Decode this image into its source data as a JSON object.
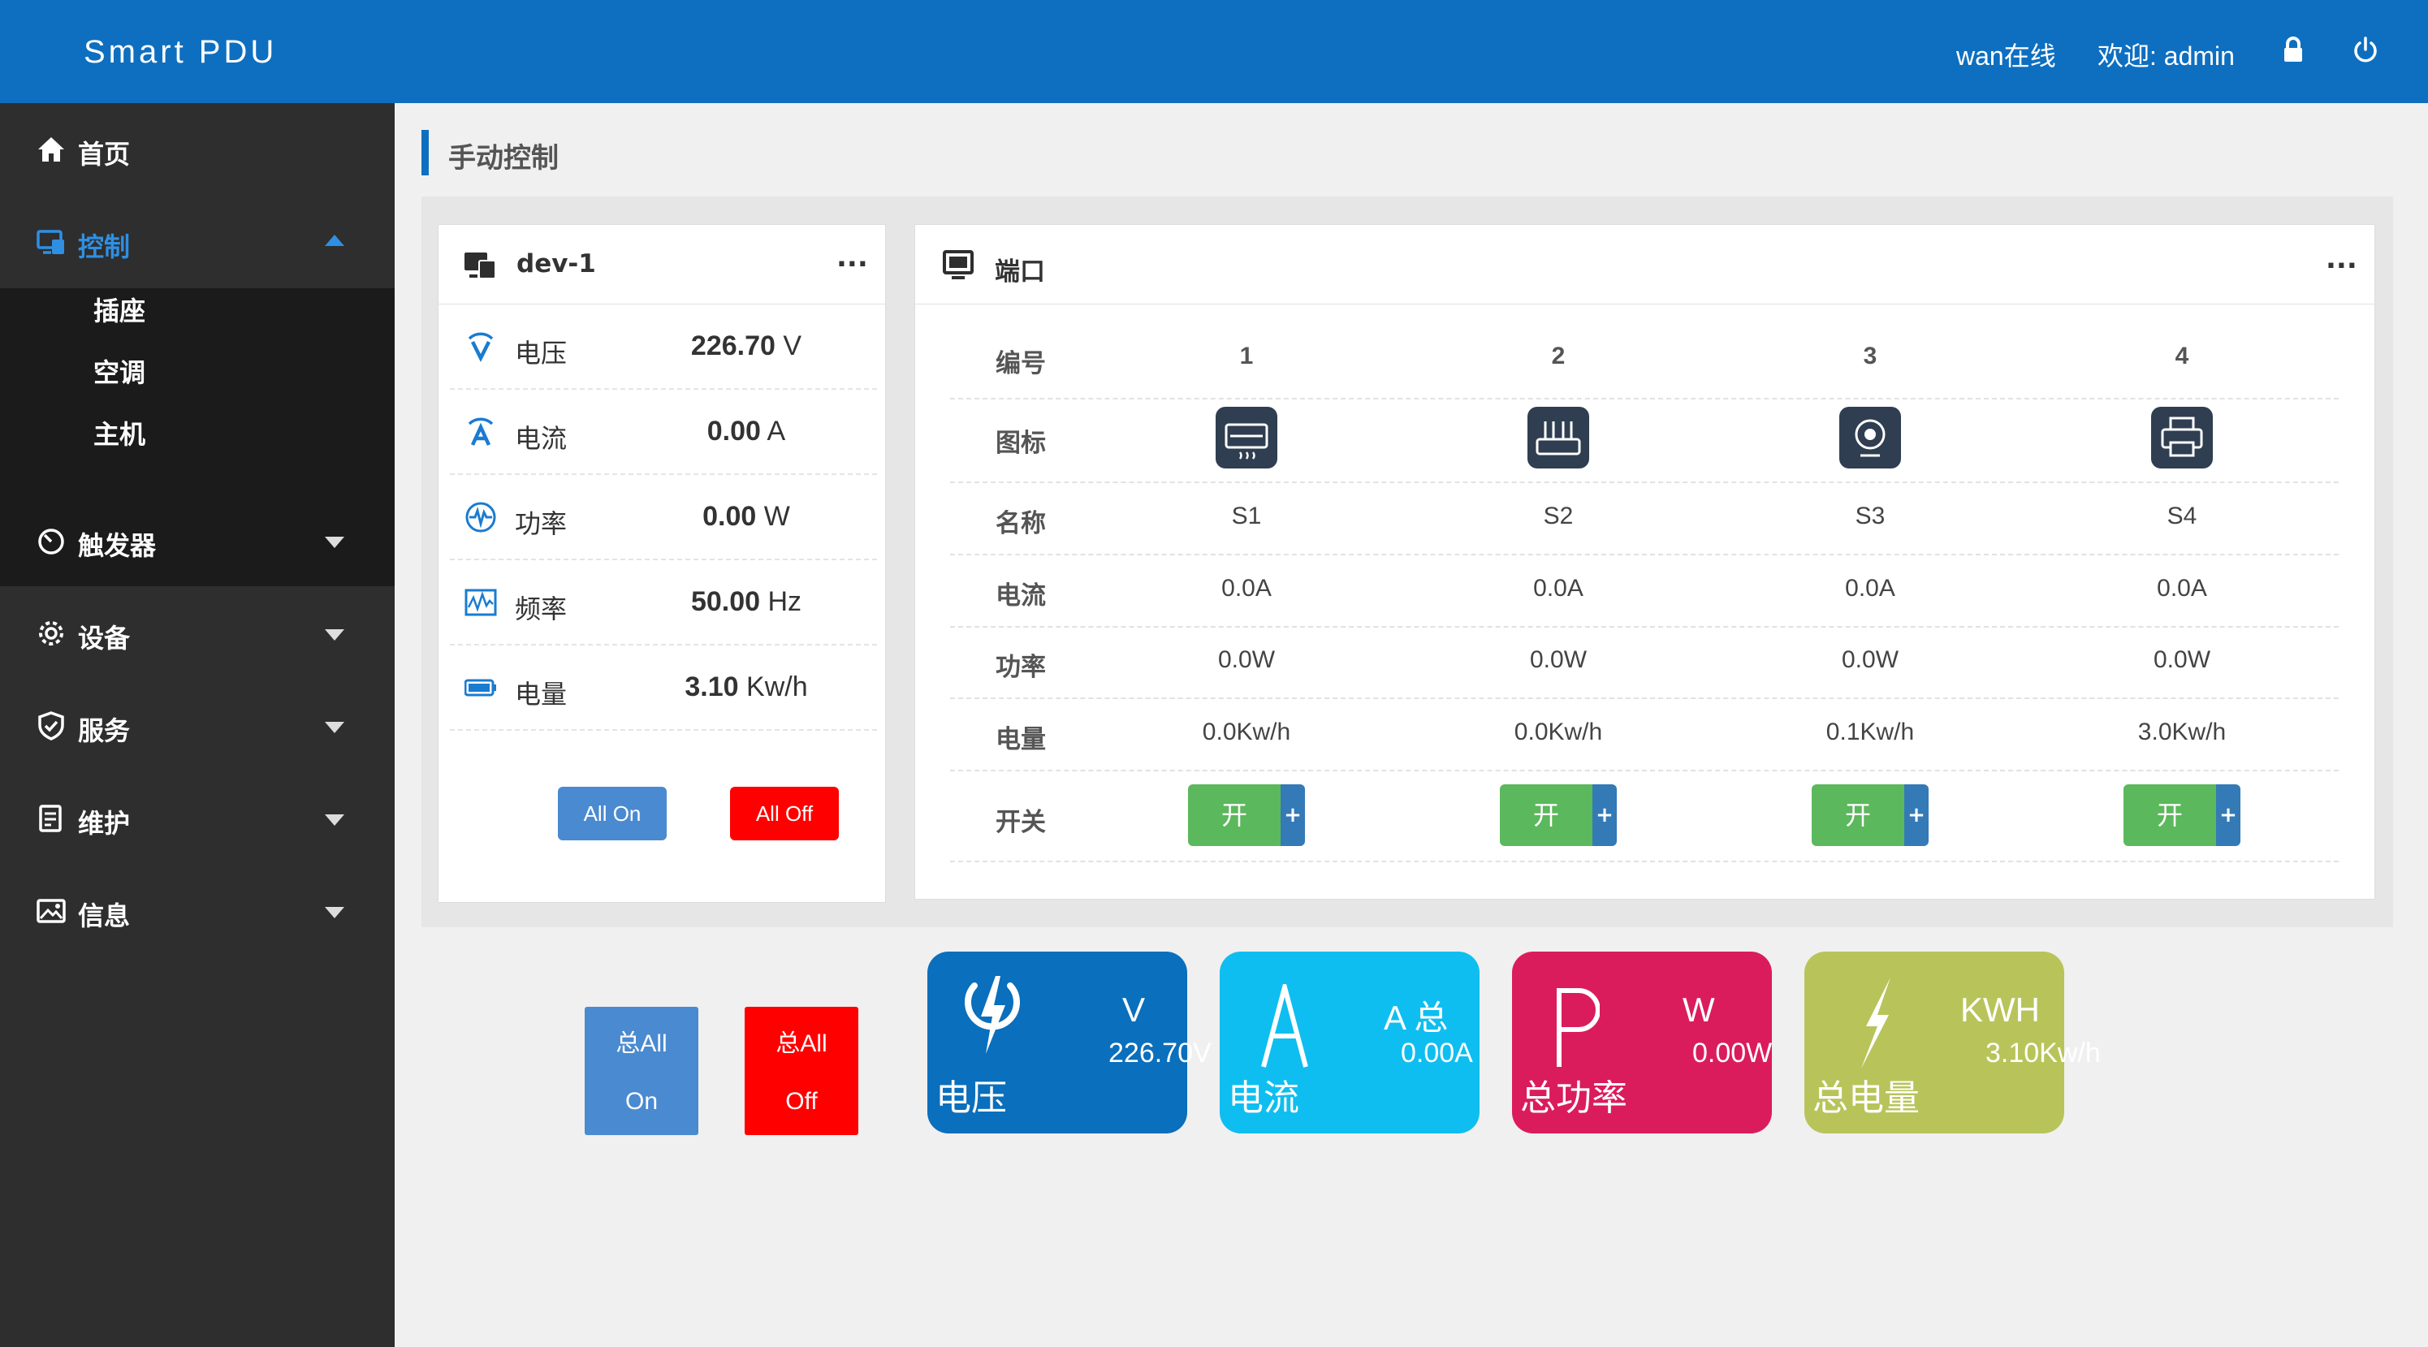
{
  "header": {
    "brand": "Smart PDU",
    "wan_status": "wan在线",
    "welcome": "欢迎: admin",
    "lock_icon": "lock-icon",
    "power_icon": "power-icon"
  },
  "sidebar": {
    "items": [
      {
        "label": "首页",
        "icon": "home-icon"
      },
      {
        "label": "控制",
        "icon": "monitor-icon",
        "active": true,
        "expanded": true
      },
      {
        "label": "触发器",
        "icon": "trigger-icon"
      },
      {
        "label": "设备",
        "icon": "gear-icon"
      },
      {
        "label": "服务",
        "icon": "shield-icon"
      },
      {
        "label": "维护",
        "icon": "clipboard-icon"
      },
      {
        "label": "信息",
        "icon": "image-icon"
      }
    ],
    "sub_items": [
      "插座",
      "空调",
      "主机"
    ]
  },
  "page": {
    "title": "手动控制"
  },
  "device_card": {
    "title": "dev-1",
    "menu": "...",
    "stats": [
      {
        "label": "电压",
        "value": "226.70",
        "unit": "V"
      },
      {
        "label": "电流",
        "value": "0.00",
        "unit": "A"
      },
      {
        "label": "功率",
        "value": "0.00",
        "unit": "W"
      },
      {
        "label": "频率",
        "value": "50.00",
        "unit": "Hz"
      },
      {
        "label": "电量",
        "value": "3.10",
        "unit": "Kw/h"
      }
    ],
    "all_on": "All On",
    "all_off": "All Off"
  },
  "port_card": {
    "title": "端口",
    "menu": "...",
    "row_labels": [
      "编号",
      "图标",
      "名称",
      "电流",
      "功率",
      "电量",
      "开关"
    ],
    "ports": [
      {
        "number": "1",
        "icon": "air-conditioner-icon",
        "name": "S1",
        "current": "0.0A",
        "power": "0.0W",
        "energy": "0.0Kw/h",
        "switch": "开",
        "plus": "+"
      },
      {
        "number": "2",
        "icon": "router-icon",
        "name": "S2",
        "current": "0.0A",
        "power": "0.0W",
        "energy": "0.0Kw/h",
        "switch": "开",
        "plus": "+"
      },
      {
        "number": "3",
        "icon": "webcam-icon",
        "name": "S3",
        "current": "0.0A",
        "power": "0.0W",
        "energy": "0.1Kw/h",
        "switch": "开",
        "plus": "+"
      },
      {
        "number": "4",
        "icon": "printer-icon",
        "name": "S4",
        "current": "0.0A",
        "power": "0.0W",
        "energy": "3.0Kw/h",
        "switch": "开",
        "plus": "+"
      }
    ]
  },
  "totals": {
    "all_on": {
      "line1": "总All",
      "line2": "On"
    },
    "all_off": {
      "line1": "总All",
      "line2": "Off"
    },
    "tiles": [
      {
        "name": "电压",
        "unit": "V",
        "value": "226.70V",
        "color": "#0a6fbc",
        "symbol": "lightning-power-icon"
      },
      {
        "name": "电流",
        "unit": "A 总",
        "value": "0.00A",
        "color": "#0fbef0",
        "symbol": "letter-a-icon"
      },
      {
        "name": "总功率",
        "unit": "W",
        "value": "0.00W",
        "color": "#da1c5d",
        "symbol": "letter-p-icon"
      },
      {
        "name": "总电量",
        "unit": "KWH",
        "value": "3.10Kw/h",
        "color": "#b8c45a",
        "symbol": "lightning-icon"
      }
    ]
  }
}
